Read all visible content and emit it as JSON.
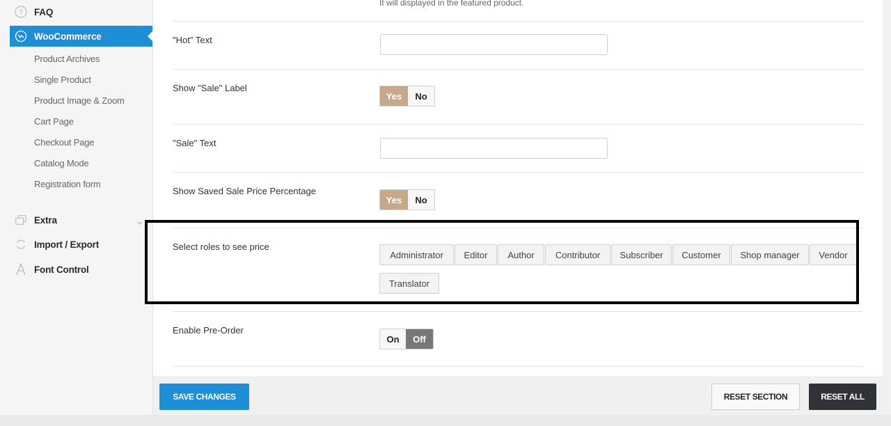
{
  "sidebar": {
    "faq": {
      "label": "FAQ",
      "icon": "question-circle-icon"
    },
    "woocommerce": {
      "label": "WooCommerce",
      "icon": "woocommerce-icon",
      "color": "#1e8ed6"
    },
    "sub_items": [
      "Product Archives",
      "Single Product",
      "Product Image & Zoom",
      "Cart Page",
      "Checkout Page",
      "Catalog Mode",
      "Registration form"
    ],
    "extra": {
      "label": "Extra",
      "icon": "layers-icon"
    },
    "import_export": {
      "label": "Import / Export",
      "icon": "refresh-icon"
    },
    "font_control": {
      "label": "Font Control",
      "icon": "font-icon"
    }
  },
  "main": {
    "featured_help": "It will displayed in the featured product.",
    "hot_text": {
      "label": "\"Hot\" Text",
      "value": ""
    },
    "show_sale_label": {
      "label": "Show \"Sale\" Label",
      "yes": "Yes",
      "no": "No",
      "selected": "Yes"
    },
    "sale_text": {
      "label": "\"Sale\" Text",
      "value": ""
    },
    "show_saved_pct": {
      "label": "Show Saved Sale Price Percentage",
      "yes": "Yes",
      "no": "No",
      "selected": "Yes"
    },
    "roles": {
      "label": "Select roles to see price",
      "options": [
        "Administrator",
        "Editor",
        "Author",
        "Contributor",
        "Subscriber",
        "Customer",
        "Shop manager",
        "Vendor",
        "Translator"
      ]
    },
    "pre_order": {
      "label": "Enable Pre-Order",
      "on": "On",
      "off": "Off",
      "selected": "Off"
    }
  },
  "footer": {
    "save": "SAVE CHANGES",
    "reset_section": "RESET SECTION",
    "reset_all": "RESET ALL"
  },
  "colors": {
    "accent": "#1e8ed6",
    "toggle_yes": "#c8a88d",
    "toggle_off": "#777777",
    "dark_button": "#2f3237"
  }
}
